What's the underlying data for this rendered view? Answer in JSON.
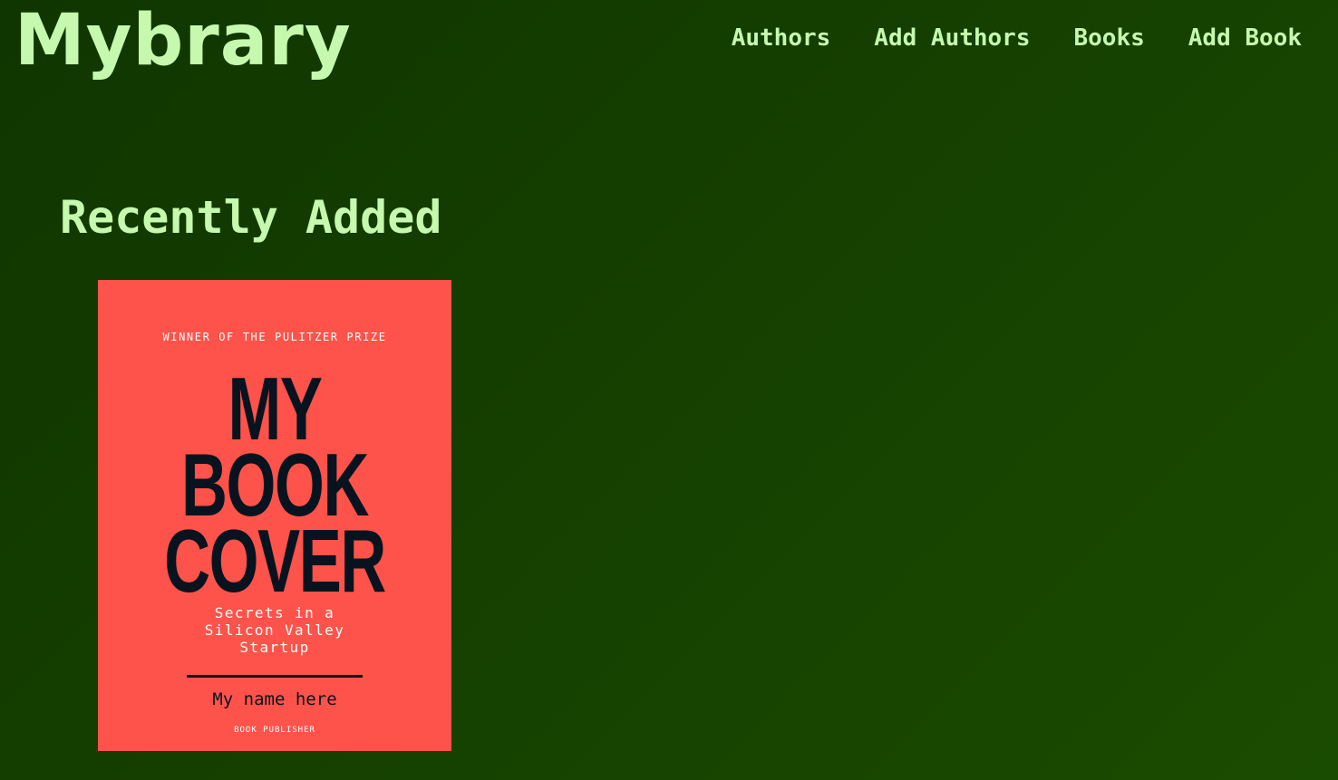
{
  "header": {
    "logo": "Mybrary",
    "nav": [
      {
        "label": "Authors"
      },
      {
        "label": "Add Authors"
      },
      {
        "label": "Books"
      },
      {
        "label": "Add Book"
      }
    ]
  },
  "main": {
    "section_title": "Recently Added",
    "books": [
      {
        "cover": {
          "award": "WINNER OF THE PULITZER PRIZE",
          "title_lines": [
            "MY",
            "BOOK",
            "COVER"
          ],
          "subtitle": "Secrets in a Silicon Valley Startup",
          "author": "My name here",
          "publisher": "BOOK PUBLISHER",
          "background_color": "#fe534a",
          "title_color": "#07131f"
        }
      }
    ]
  },
  "colors": {
    "background": "#153f00",
    "accent": "#c6f9ad"
  }
}
